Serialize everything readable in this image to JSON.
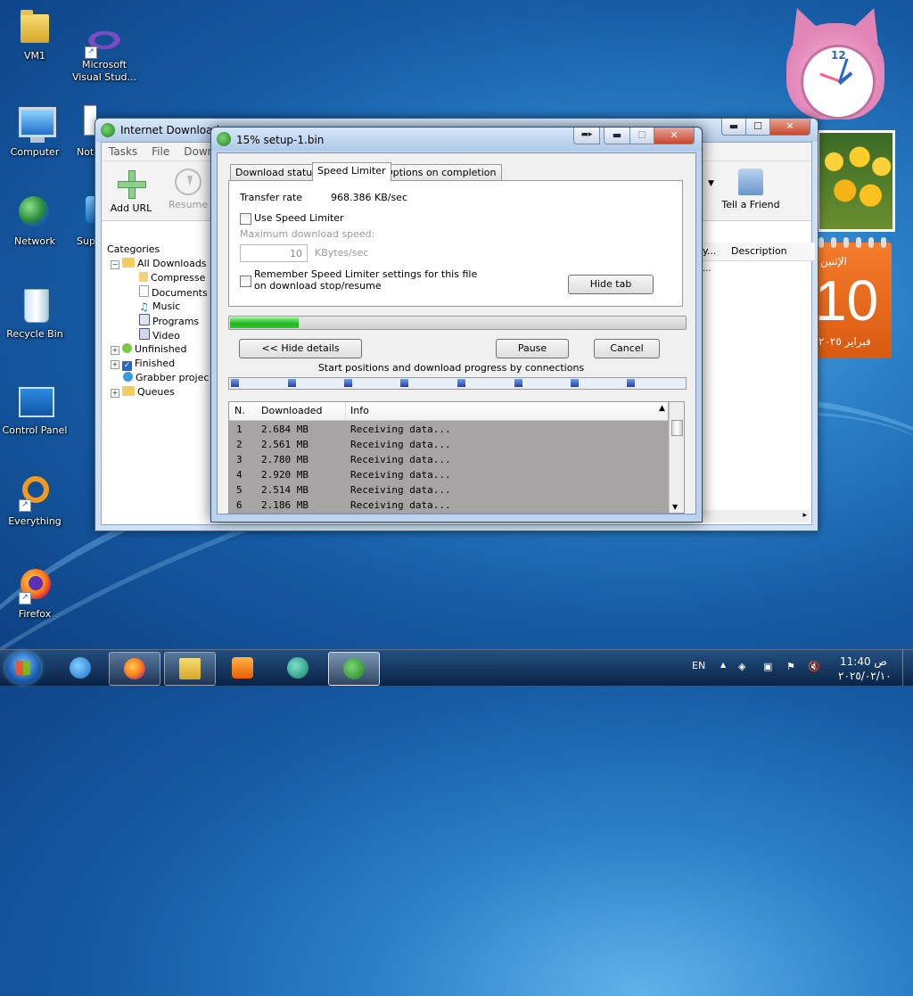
{
  "desktop": {
    "icons": [
      {
        "label": "VM1"
      },
      {
        "label": "Microsoft Visual Stud..."
      },
      {
        "label": "Computer"
      },
      {
        "label": "Not"
      },
      {
        "label": "Network"
      },
      {
        "label": "Sup"
      },
      {
        "label": "Recycle Bin"
      },
      {
        "label": "Control Panel"
      },
      {
        "label": "Everything"
      },
      {
        "label": "Firefox"
      }
    ],
    "calendar": {
      "day_name": "الإثنين",
      "day_number": "10",
      "month_year": "فبراير ٢٠٢٥"
    },
    "clock": {
      "numeral_12": "12"
    }
  },
  "idm_main": {
    "title": "Internet Download",
    "menu": [
      "Tasks",
      "File",
      "Downlo"
    ],
    "toolbar": {
      "add_url": "Add URL",
      "resume": "Resume",
      "tell_friend": "Tell a Friend"
    },
    "categories_title": "Categories",
    "categories": [
      "All Downloads",
      "Compresse",
      "Documents",
      "Music",
      "Programs",
      "Video",
      "Unfinished",
      "Finished",
      "Grabber projec",
      "Queues"
    ],
    "list_headers": {
      "col1": "y...",
      "description": "Description"
    },
    "list_row_partial": "..."
  },
  "dialog": {
    "title": "15% setup-1.bin",
    "tabs": {
      "status": "Download status",
      "limiter": "Speed Limiter",
      "completion": "Options on completion"
    },
    "transfer_rate_label": "Transfer rate",
    "transfer_rate_value": "968.386  KB/sec",
    "use_speed_limiter": "Use Speed Limiter",
    "max_speed_label": "Maximum download speed:",
    "max_speed_value": "10",
    "max_speed_unit": "KBytes/sec",
    "remember_line1": "Remember Speed Limiter settings for this file",
    "remember_line2": "on download stop/resume",
    "hide_tab": "Hide tab",
    "progress_fraction": 0.15,
    "hide_details": "<< Hide details",
    "pause": "Pause",
    "cancel": "Cancel",
    "connections_caption": "Start positions and download progress by connections",
    "table_headers": {
      "n": "N.",
      "downloaded": "Downloaded",
      "info": "Info"
    },
    "rows": [
      {
        "n": "1",
        "downloaded": "2.684  MB",
        "info": "Receiving data..."
      },
      {
        "n": "2",
        "downloaded": "2.561  MB",
        "info": "Receiving data..."
      },
      {
        "n": "3",
        "downloaded": "2.780  MB",
        "info": "Receiving data..."
      },
      {
        "n": "4",
        "downloaded": "2.920  MB",
        "info": "Receiving data..."
      },
      {
        "n": "5",
        "downloaded": "2.514  MB",
        "info": "Receiving data..."
      },
      {
        "n": "6",
        "downloaded": "2.186  MB",
        "info": "Receiving data..."
      }
    ]
  },
  "taskbar": {
    "language": "EN",
    "time": "11:40 ص",
    "date": "٢٠٢٥/٠٢/١٠"
  },
  "colors": {
    "progress_green": "#1fb31f",
    "calendar_orange": "#e8661a",
    "accent_blue": "#1e3fb6"
  }
}
